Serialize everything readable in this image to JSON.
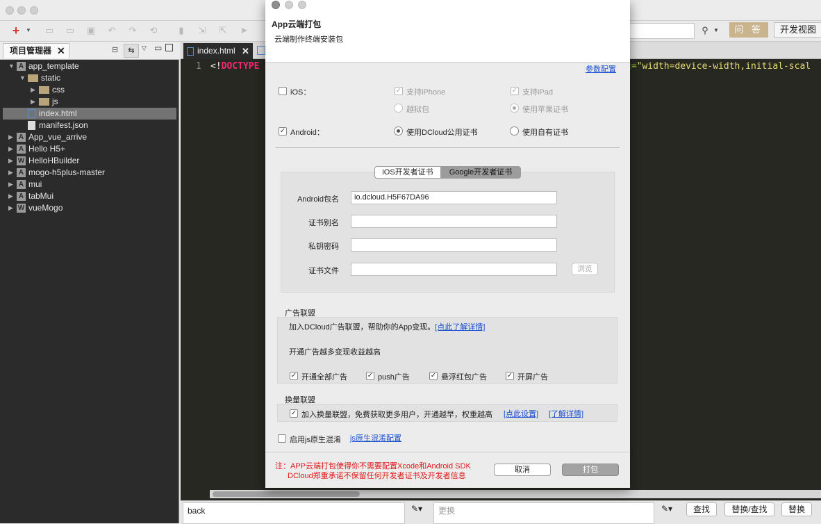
{
  "top_right_buttons": {
    "ask": "问 答",
    "dev_view": "开发视图"
  },
  "sidebar": {
    "title": "项目管理器",
    "items": [
      {
        "label": "app_template",
        "badge": "A"
      },
      {
        "label": "static"
      },
      {
        "label": "css"
      },
      {
        "label": "js"
      },
      {
        "label": "index.html"
      },
      {
        "label": "manifest.json"
      },
      {
        "label": "App_vue_arrive",
        "badge": "A"
      },
      {
        "label": "Hello H5+",
        "badge": "A"
      },
      {
        "label": "HelloHBuilder",
        "badge": "W"
      },
      {
        "label": "mogo-h5plus-master",
        "badge": "A"
      },
      {
        "label": "mui",
        "badge": "A"
      },
      {
        "label": "tabMui",
        "badge": "A"
      },
      {
        "label": "vueMogo",
        "badge": "W"
      }
    ]
  },
  "editor": {
    "tab": "index.html",
    "line_number": "1",
    "code_prefix": "<!",
    "code_keyword": "DOCTYPE",
    "code_right_a": "t=",
    "code_right_b": "\"width=device-width,initial-scal"
  },
  "bottom_bar": {
    "find_value": "back",
    "replace_placeholder": "更换",
    "find_button": "查找",
    "replace_find_button": "替换/查找",
    "replace_button": "替换"
  },
  "dialog": {
    "title": "App云端打包",
    "subtitle": "云端制作终端安装包",
    "param_link": "参数配置",
    "ios": {
      "label": "iOS：",
      "checked": false,
      "support_iphone": "支持iPhone",
      "support_ipad": "支持iPad",
      "jailbreak": "越狱包",
      "apple_cert": "使用苹果证书"
    },
    "android": {
      "label": "Android：",
      "checked": true,
      "dcloud_cert": "使用DCloud公用证书",
      "own_cert": "使用自有证书"
    },
    "cert_tabs": [
      "iOS开发者证书",
      "Google开发者证书"
    ],
    "cert_active_tab": "Google开发者证书",
    "fields": {
      "package_label": "Android包名",
      "package_value": "io.dcloud.H5F67DA96",
      "alias_label": "证书别名",
      "alias_value": "",
      "key_label": "私钥密码",
      "key_value": "",
      "file_label": "证书文件",
      "file_value": "",
      "browse": "浏览"
    },
    "ad": {
      "section": "广告联盟",
      "join_text": "加入DCloud广告联盟，帮助你的App变现。",
      "learn_more": "[点此了解详情]",
      "more_text": "开通广告越多变现收益越高",
      "options": [
        {
          "label": "开通全部广告",
          "checked": true
        },
        {
          "label": "push广告",
          "checked": true
        },
        {
          "label": "悬浮红包广告",
          "checked": true
        },
        {
          "label": "开屏广告",
          "checked": true
        }
      ]
    },
    "exchange": {
      "section": "换量联盟",
      "text": "加入换量联盟，免费获取更多用户，开通越早，权重越高",
      "setup_link": "[点此设置]",
      "detail_link": "[了解详情]"
    },
    "obfuscate": {
      "label": "启用js原生混淆",
      "checked": false,
      "config_link": "js原生混淆配置"
    },
    "note_line1": "注：APP云端打包使得你不需要配置Xcode和Android SDK",
    "note_line2": "DCloud郑重承诺不保留任何开发者证书及开发者信息",
    "cancel": "取消",
    "pack": "打包",
    "note_color": "#e01818"
  }
}
